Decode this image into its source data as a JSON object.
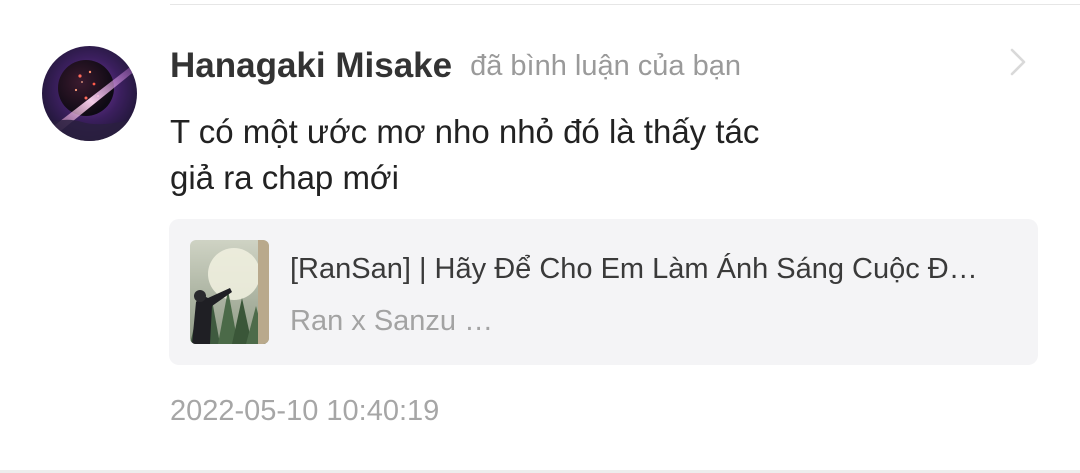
{
  "notification": {
    "username": "Hanagaki Misake",
    "action": "đã bình luận của bạn",
    "comment_line1": "T có một ước mơ nho nhỏ đó là thấy tác",
    "comment_line2": "giả ra chap mới",
    "story": {
      "title": "[RanSan] | Hãy Để Cho Em Làm Ánh Sáng Cuộc Đ…",
      "subtitle": "Ran x Sanzu …"
    },
    "timestamp": "2022-05-10 10:40:19",
    "icons": {
      "avatar": "user-avatar",
      "thumbnail": "story-cover",
      "navigate": "chevron-right-icon"
    }
  },
  "colors": {
    "username": "#333333",
    "secondary_text": "#9a9a9a",
    "card_background": "#f4f4f6",
    "timestamp": "#a6a6a6"
  }
}
